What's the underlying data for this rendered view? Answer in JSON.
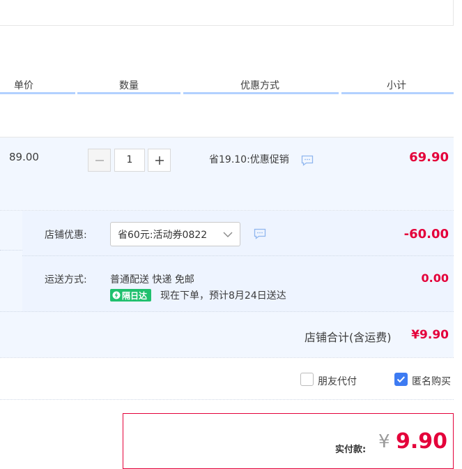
{
  "table_header": {
    "unit_price": "单价",
    "quantity": "数量",
    "discount_method": "优惠方式",
    "subtotal": "小计"
  },
  "item": {
    "unit_price": "89.00",
    "quantity": "1",
    "discount": "省19.10:优惠促销",
    "subtotal": "69.90"
  },
  "shop_discount": {
    "label": "店铺优惠:",
    "selected": "省60元:活动券0822",
    "amount": "-60.00"
  },
  "shipping": {
    "label": "运送方式:",
    "method": "普通配送 快递 免邮",
    "badge": "隔日达",
    "eta": "现在下单，预计8月24日送达",
    "amount": "0.00"
  },
  "shop_total": {
    "label": "店铺合计(含运费)",
    "amount": "¥9.90"
  },
  "options": {
    "friend_pay": "朋友代付",
    "friend_pay_checked": false,
    "anonymous": "匿名购买",
    "anonymous_checked": true
  },
  "payment": {
    "label": "实付款:",
    "currency": "¥",
    "amount": "9.90"
  },
  "colors": {
    "accent_red": "#e4003a",
    "header_line": "#b2d1ff",
    "row_bg": "#f2f7ff",
    "badge_green": "#20c06e",
    "checkbox_blue": "#3d7bf2"
  }
}
